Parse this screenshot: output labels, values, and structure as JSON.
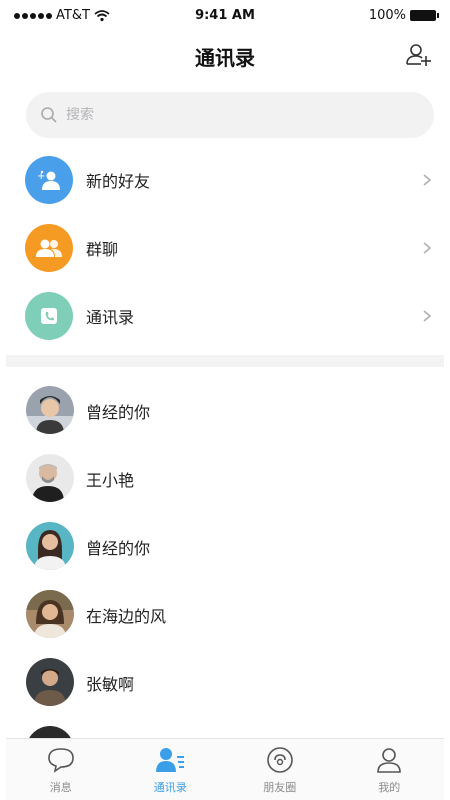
{
  "status_bar": {
    "carrier": "AT&T",
    "time": "9:41 AM",
    "battery": "100%"
  },
  "nav": {
    "title": "通讯录",
    "add_contact_icon": "add-person-icon"
  },
  "search": {
    "placeholder": "搜索",
    "value": ""
  },
  "menu": [
    {
      "label": "新的好友",
      "icon": "new-friend-icon",
      "color": "#4a9fea"
    },
    {
      "label": "群聊",
      "icon": "group-chat-icon",
      "color": "#f59a23"
    },
    {
      "label": "通讯录",
      "icon": "phone-book-icon",
      "color": "#7fcfb8"
    }
  ],
  "contacts": [
    {
      "name": "曾经的你"
    },
    {
      "name": "王小艳"
    },
    {
      "name": "曾经的你"
    },
    {
      "name": "在海边的风"
    },
    {
      "name": "张敏啊"
    }
  ],
  "tabs": [
    {
      "label": "消息",
      "icon": "chat-bubble-icon",
      "active": false
    },
    {
      "label": "通讯录",
      "icon": "contacts-icon",
      "active": true
    },
    {
      "label": "朋友圈",
      "icon": "moments-icon",
      "active": false
    },
    {
      "label": "我的",
      "icon": "profile-icon",
      "active": false
    }
  ],
  "colors": {
    "accent": "#3a9ee8",
    "search_bg": "#f2f2f3",
    "divider": "#f3f3f4"
  }
}
